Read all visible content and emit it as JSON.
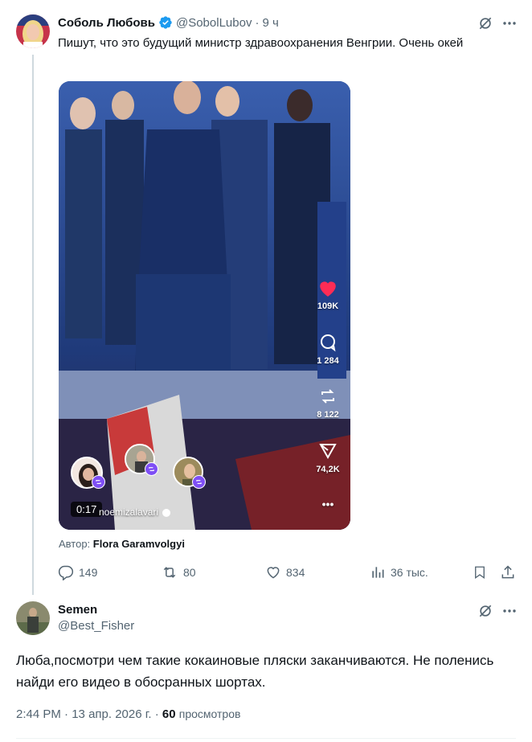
{
  "tweet": {
    "author_name": "Соболь Любовь",
    "author_handle": "@SobolLubov",
    "time_sep": "·",
    "time": "9 ч",
    "text": "Пишут, что это будущий министр здравоохранения Венгрии. Очень окей",
    "verified": true,
    "avatar_icon": "avatar-woman-blonde"
  },
  "video": {
    "likes": "109K",
    "comments": "1 284",
    "reposts": "8 122",
    "shares": "74,2K",
    "duration": "0:17",
    "tiktok_user": "noemizalavari",
    "credit_label": "Автор:",
    "credit_name": "Flora Garamvolgyi"
  },
  "actions": {
    "replies": "149",
    "retweets": "80",
    "likes": "834",
    "views": "36 тыс."
  },
  "reply": {
    "author_name": "Semen",
    "author_handle": "@Best_Fisher",
    "text": "Люба,посмотри чем такие кокаиновые пляски заканчиваются. Не поленись найди его видео в обосранных шортах.",
    "time": "2:44 PM",
    "sep": "·",
    "date": "13 апр. 2026 г.",
    "sep2": "·",
    "views_count": "60",
    "views_label": "просмотров"
  },
  "colors": {
    "text_primary": "#0f1419",
    "text_secondary": "#536471",
    "verified_blue": "#1d9bf0",
    "like_red": "#f91880",
    "divider": "#cfd9de"
  }
}
